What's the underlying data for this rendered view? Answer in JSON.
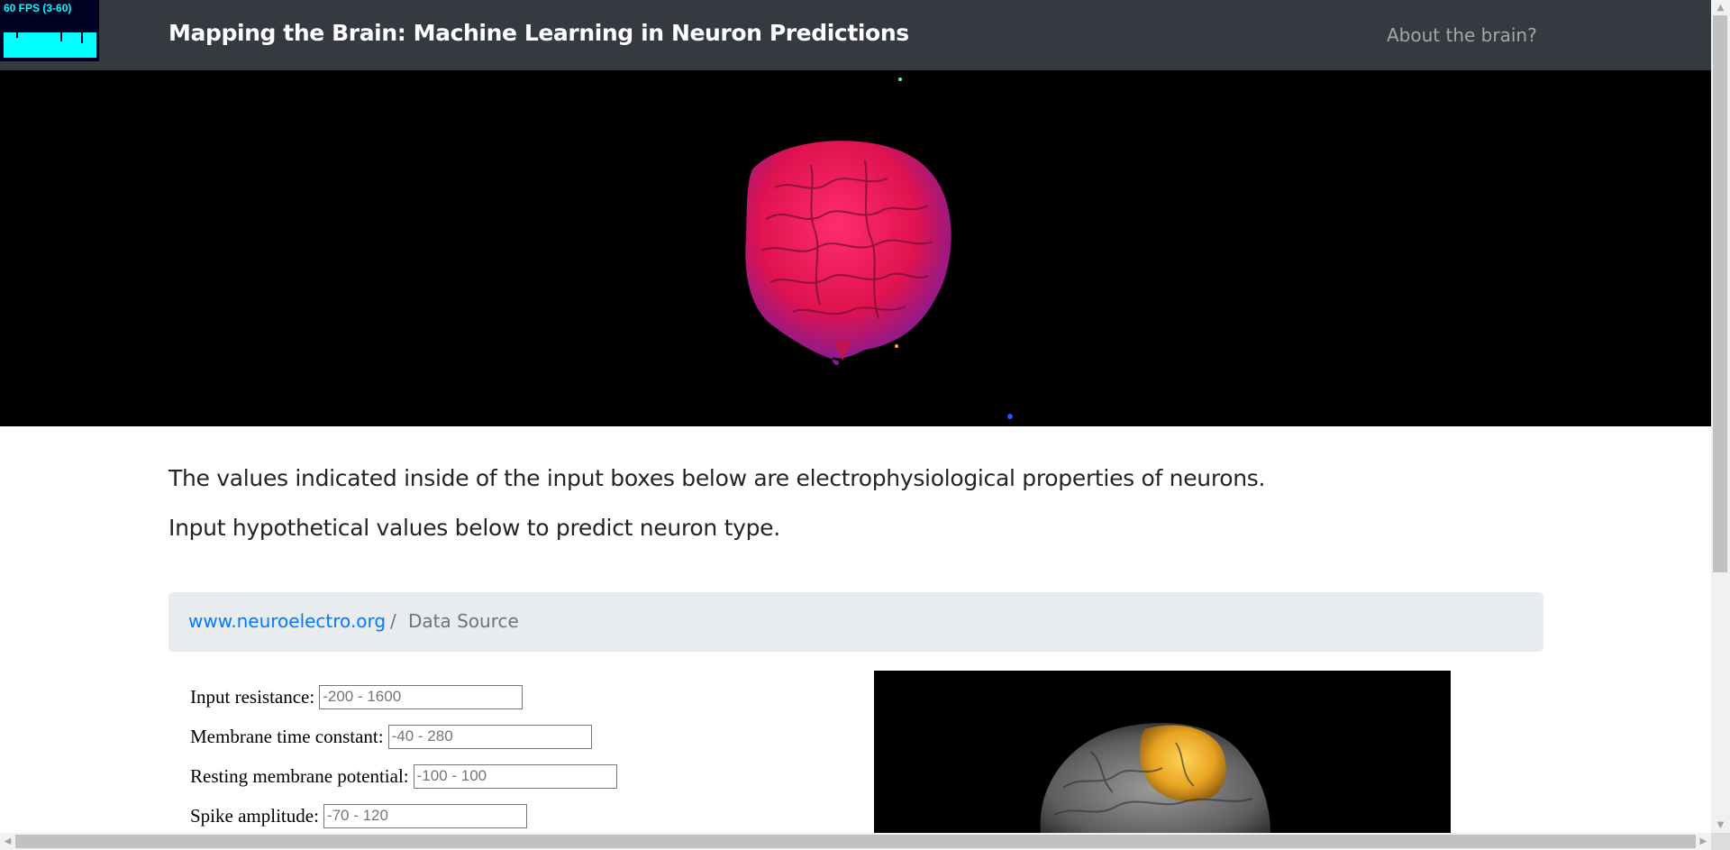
{
  "fps_meter": {
    "label": "60 FPS (3-60)"
  },
  "navbar": {
    "title": "Mapping the Brain: Machine Learning in Neuron Predictions",
    "about_link": "About the brain?"
  },
  "hero": {
    "brain_color_primary": "#ff1a5e",
    "brain_color_secondary": "#3b2bd6",
    "background": "#000000"
  },
  "intro": {
    "line1": "The values indicated inside of the input boxes below are electrophysiological properties of neurons.",
    "line2": "Input hypothetical values below to predict neuron type."
  },
  "breadcrumb": {
    "link_text": "www.neuroelectro.org",
    "separator": "/",
    "active_text": "Data Source"
  },
  "form": {
    "fields": [
      {
        "label": "Input resistance:",
        "placeholder": "-200 - 1600"
      },
      {
        "label": "Membrane time constant:",
        "placeholder": "-40 - 280"
      },
      {
        "label": "Resting membrane potential:",
        "placeholder": "-100 - 100"
      },
      {
        "label": "Spike amplitude:",
        "placeholder": "-70 - 120"
      }
    ]
  },
  "preview": {
    "brain_color": "#8a8a8a",
    "highlight_color": "#f2b632"
  },
  "colors": {
    "navbar_bg": "#343a40",
    "link": "#007bff",
    "breadcrumb_bg": "#e9ecef"
  }
}
